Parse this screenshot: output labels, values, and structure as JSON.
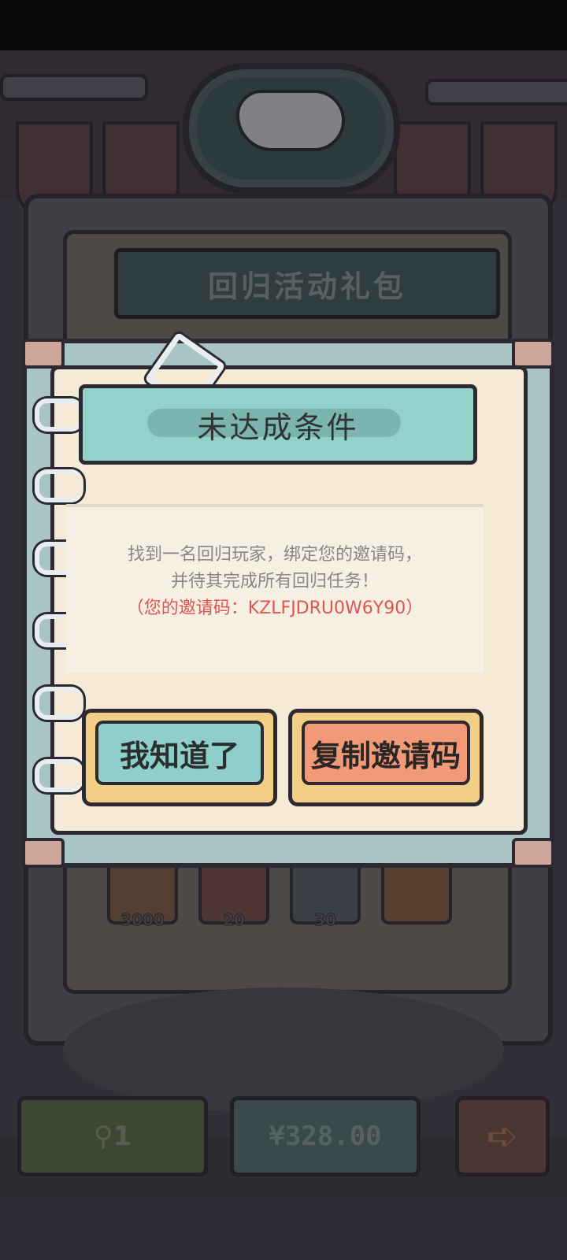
{
  "background": {
    "panel_title": "回归活动礼包",
    "rewards": [
      {
        "icon": "ghost-icon",
        "count": "3000"
      },
      {
        "icon": "ticket-icon",
        "count": "20"
      },
      {
        "icon": "potion-icon",
        "count": "30"
      },
      {
        "icon": "ring-icon",
        "count": ""
      }
    ],
    "bottom_bar": {
      "ghost_count": "1",
      "price": "¥328.00"
    }
  },
  "dialog": {
    "title": "未达成条件",
    "message_line1": "找到一名回归玩家，绑定您的邀请码，",
    "message_line2": "并待其完成所有回归任务！",
    "invite_line": "（您的邀请码：KZLFJDRU0W6Y90）",
    "ok_label": "我知道了",
    "copy_label": "复制邀请码"
  },
  "colors": {
    "dialog_title_bg": "#93d1cb",
    "ok_button": "#8fcfcb",
    "copy_button": "#f29a78",
    "invite_code": "#e0564e"
  }
}
